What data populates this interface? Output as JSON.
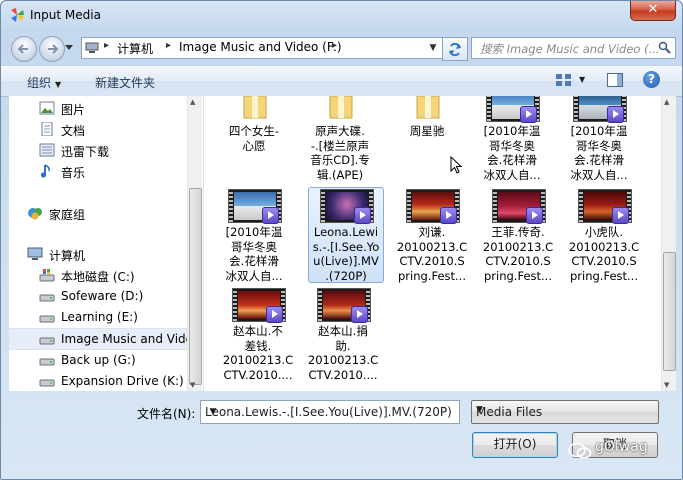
{
  "window": {
    "title": "Input Media",
    "close_glyph": "✕"
  },
  "address": {
    "crumbs": [
      "计算机",
      "Image Music and Video (F:)"
    ],
    "search_placeholder": "搜索 Image Music and Video (..."
  },
  "toolbar": {
    "organize": "组织",
    "new_folder": "新建文件夹",
    "help": "?"
  },
  "nav": {
    "items": [
      {
        "label": "图片",
        "icon": "pictures-icon"
      },
      {
        "label": "文档",
        "icon": "documents-icon"
      },
      {
        "label": "迅雷下载",
        "icon": "downloads-icon"
      },
      {
        "label": "音乐",
        "icon": "music-icon"
      },
      {
        "label": "家庭组",
        "icon": "homegroup-icon"
      },
      {
        "label": "计算机",
        "icon": "computer-icon"
      },
      {
        "label": "本地磁盘 (C:)",
        "icon": "drive-icon"
      },
      {
        "label": "Sofeware (D:)",
        "icon": "drive-icon"
      },
      {
        "label": "Learning (E:)",
        "icon": "drive-icon"
      },
      {
        "label": "Image Music and Video",
        "icon": "drive-icon",
        "selected": true
      },
      {
        "label": "Back up (G:)",
        "icon": "drive-icon"
      },
      {
        "label": "Expansion Drive (K:)",
        "icon": "drive-icon"
      }
    ]
  },
  "files": {
    "row1": [
      {
        "lines": [
          "四个女生-",
          "心愿"
        ],
        "type": "folder"
      },
      {
        "lines": [
          "原声大碟.",
          "-.[楼兰原声",
          "音乐CD].专",
          "辑.(APE)"
        ],
        "type": "folder"
      },
      {
        "lines": [
          "周星驰"
        ],
        "type": "folder"
      },
      {
        "lines": [
          "[2010年温",
          "哥华冬奥",
          "会.花样滑",
          "冰双人自..."
        ],
        "type": "video"
      },
      {
        "lines": [
          "[2010年温",
          "哥华冬奥",
          "会.花样滑",
          "冰双人自..."
        ],
        "type": "video"
      }
    ],
    "row2": [
      {
        "lines": [
          "[2010年温",
          "哥华冬奥",
          "会.花样滑",
          "冰双人自..."
        ],
        "type": "video"
      },
      {
        "lines": [
          "Leona.Lewi",
          "s.-.[I.See.Yo",
          "u(Live)].MV",
          ".(720P)"
        ],
        "type": "video",
        "selected": true
      },
      {
        "lines": [
          "刘谦.",
          "20100213.C",
          "CTV.2010.S",
          "pring.Fest..."
        ],
        "type": "video"
      },
      {
        "lines": [
          "王菲.传奇.",
          "20100213.C",
          "CTV.2010.S",
          "pring.Fest..."
        ],
        "type": "video"
      },
      {
        "lines": [
          "小虎队.",
          "20100213.C",
          "CTV.2010.S",
          "pring.Fest..."
        ],
        "type": "video"
      }
    ],
    "row3": [
      {
        "lines": [
          "赵本山.不",
          "差钱.",
          "20100213.C",
          "CTV.2010...."
        ],
        "type": "video"
      },
      {
        "lines": [
          "赵本山.捐",
          "助.",
          "20100213.C",
          "CTV.2010...."
        ],
        "type": "video"
      }
    ]
  },
  "bottom": {
    "filename_label": "文件名(N):",
    "filename_value": "Leona.Lewis.-.[I.See.You(Live)].MV.(720P)",
    "filetype": "Media Files",
    "open_button": "打开(O)",
    "cancel_button": "取消"
  },
  "watermark": "gOlwag",
  "colors": {
    "accent": "#3c7fb1",
    "selection": "#cfe1f8",
    "close": "#c4351c",
    "play": "#5b48c8"
  }
}
